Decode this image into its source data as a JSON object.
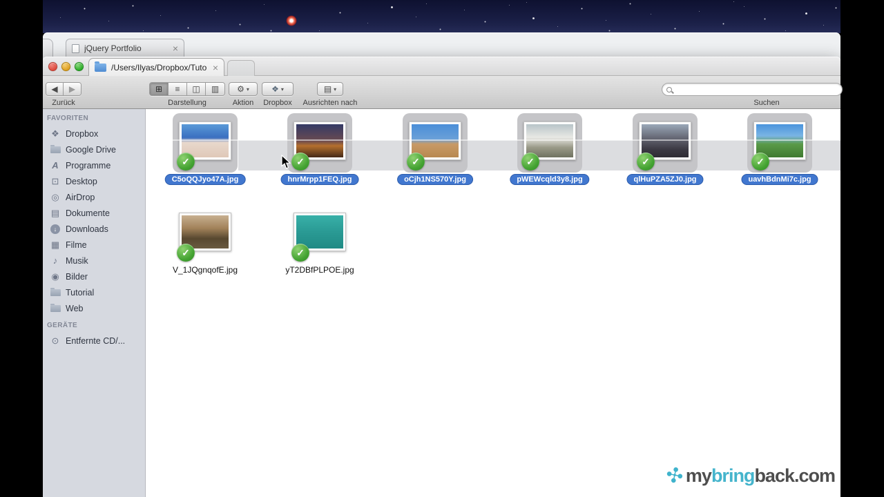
{
  "glyphs": {
    "check": "✓",
    "close": "×",
    "back": "◀",
    "forward": "▶",
    "view_grid": "⊞",
    "view_list": "≡",
    "view_columns": "◫",
    "view_coverflow": "▥",
    "gear": "⚙",
    "dropbox": "❖",
    "arrange": "▤",
    "dropdown": "▾",
    "download": "↓",
    "pinwheel": "✣"
  },
  "colors": {
    "selection_pill": "#4177cf",
    "synced_badge_green": "#3d9e2d",
    "sidebar_bg": "#d6d9e0",
    "band": "#dcdde0",
    "watermark_teal": "#45b4cc"
  },
  "browser": {
    "tab_title": "jQuery Portfolio"
  },
  "finder": {
    "tab_title": "/Users/Ilyas/Dropbox/Tuto",
    "toolbar": {
      "back_label": "Zurück",
      "view_label": "Darstellung",
      "action_label": "Aktion",
      "dropbox_label": "Dropbox",
      "arrange_label": "Ausrichten nach",
      "search_label": "Suchen",
      "search_value": ""
    },
    "sidebar": {
      "favorites_header": "FAVORITEN",
      "devices_header": "GERÄTE",
      "favorites": [
        {
          "label": "Dropbox",
          "glyph": "❖",
          "icon": "dropbox-icon"
        },
        {
          "label": "Google Drive",
          "icon": "folder-icon"
        },
        {
          "label": "Programme",
          "glyph": "A",
          "icon": "applications-icon"
        },
        {
          "label": "Desktop",
          "glyph": "⊡",
          "icon": "desktop-icon"
        },
        {
          "label": "AirDrop",
          "glyph": "◎",
          "icon": "airdrop-icon"
        },
        {
          "label": "Dokumente",
          "glyph": "▤",
          "icon": "documents-icon"
        },
        {
          "label": "Downloads",
          "glyph": "↓",
          "icon": "downloads-icon"
        },
        {
          "label": "Filme",
          "glyph": "▦",
          "icon": "movies-icon"
        },
        {
          "label": "Musik",
          "glyph": "♪",
          "icon": "music-icon"
        },
        {
          "label": "Bilder",
          "glyph": "◉",
          "icon": "pictures-icon"
        },
        {
          "label": "Tutorial",
          "icon": "folder-icon"
        },
        {
          "label": "Web",
          "icon": "folder-icon"
        }
      ],
      "devices": [
        {
          "label": "Entfernte CD/...",
          "glyph": "⊙",
          "icon": "disc-icon"
        }
      ]
    },
    "files": {
      "items": [
        {
          "name": "C5oQQJyo47A.jpg",
          "selected": true,
          "thumb": [
            [
              "#5a9ad8",
              0
            ],
            [
              "#3a6fc0",
              40
            ],
            [
              "#e8d8cc",
              55
            ],
            [
              "#dfc8b8",
              100
            ]
          ]
        },
        {
          "name": "hnrMrpp1FEQ.jpg",
          "selected": true,
          "thumb": [
            [
              "#343a66",
              0
            ],
            [
              "#6a4a50",
              50
            ],
            [
              "#b5702e",
              65
            ],
            [
              "#452a18",
              100
            ]
          ]
        },
        {
          "name": "oCjh1NS570Y.jpg",
          "selected": true,
          "thumb": [
            [
              "#4a8ed8",
              0
            ],
            [
              "#6aa0d8",
              45
            ],
            [
              "#c89a66",
              60
            ],
            [
              "#b88850",
              100
            ]
          ]
        },
        {
          "name": "pWEWcqld3y8.jpg",
          "selected": true,
          "thumb": [
            [
              "#b8c4c8",
              0
            ],
            [
              "#e8e8e4",
              40
            ],
            [
              "#9a9a88",
              70
            ],
            [
              "#6f7260",
              100
            ]
          ]
        },
        {
          "name": "qlHuPZA5ZJ0.jpg",
          "selected": true,
          "thumb": [
            [
              "#9aa8b8",
              0
            ],
            [
              "#5a5a66",
              50
            ],
            [
              "#3c3a44",
              75
            ],
            [
              "#2e2c34",
              100
            ]
          ]
        },
        {
          "name": "uavhBdnMi7c.jpg",
          "selected": true,
          "thumb": [
            [
              "#4a94dc",
              0
            ],
            [
              "#7ab4e4",
              35
            ],
            [
              "#5a9a48",
              60
            ],
            [
              "#3f7a30",
              100
            ]
          ]
        },
        {
          "name": "V_1JQgnqofE.jpg",
          "selected": false,
          "thumb": [
            [
              "#c8b090",
              0
            ],
            [
              "#a08058",
              40
            ],
            [
              "#584830",
              70
            ],
            [
              "#6a5a40",
              100
            ]
          ]
        },
        {
          "name": "yT2DBfPLPOE.jpg",
          "selected": false,
          "thumb": [
            [
              "#38b0a8",
              0
            ],
            [
              "#2a9a94",
              50
            ],
            [
              "#1f8a84",
              100
            ]
          ]
        }
      ]
    }
  },
  "watermark": {
    "part1": "my",
    "part2": "bring",
    "part3": "back.com"
  }
}
